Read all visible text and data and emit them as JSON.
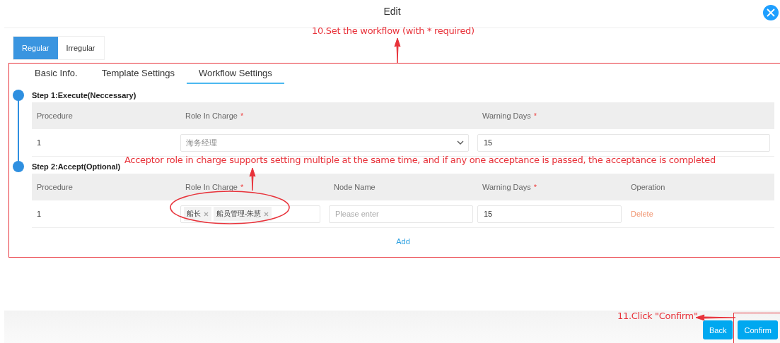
{
  "dialog": {
    "title": "Edit"
  },
  "mode_tabs": [
    {
      "label": "Regular",
      "selected": true
    },
    {
      "label": "Irregular",
      "selected": false
    }
  ],
  "tabs": [
    {
      "label": "Basic Info.",
      "selected": false
    },
    {
      "label": "Template Settings",
      "selected": false
    },
    {
      "label": "Workflow Settings",
      "selected": true
    }
  ],
  "steps": [
    {
      "title": "Step 1:Execute(Neccessary)",
      "columns": [
        {
          "label": "Procedure",
          "required": false
        },
        {
          "label": "Role In Charge",
          "required": true
        },
        {
          "label": "Warning Days",
          "required": true
        }
      ],
      "rows": [
        {
          "procedure": "1",
          "role": {
            "kind": "select",
            "value": "海务经理"
          },
          "warning_days": "15"
        }
      ]
    },
    {
      "title": "Step 2:Accept(Optional)",
      "columns": [
        {
          "label": "Procedure",
          "required": false
        },
        {
          "label": "Role In Charge",
          "required": true
        },
        {
          "label": "Node Name",
          "required": false
        },
        {
          "label": "Warning Days",
          "required": true
        },
        {
          "label": "Operation",
          "required": false
        }
      ],
      "rows": [
        {
          "procedure": "1",
          "role": {
            "kind": "tags",
            "tags": [
              "船长",
              "船员管理-朱慧"
            ]
          },
          "node_name": {
            "placeholder": "Please enter"
          },
          "warning_days": "15",
          "operation": "Delete"
        }
      ],
      "add": "Add"
    }
  ],
  "required_mark": "*",
  "footer": {
    "buttons": [
      "Back",
      "Confirm"
    ]
  },
  "annotations": {
    "workflow": "10.Set the workflow  (with * required)",
    "acceptor": "Acceptor role in charge supports setting multiple at the same time, and if any one acceptance is passed, the acceptance is completed",
    "confirm": "11.Click \"Confirm\""
  }
}
